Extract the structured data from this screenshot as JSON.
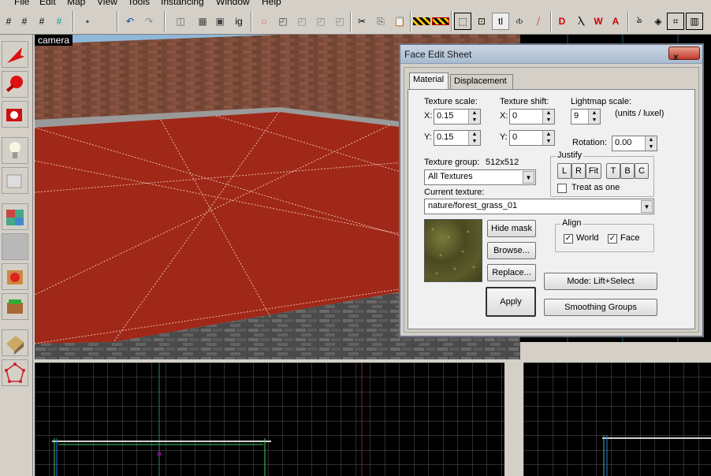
{
  "menubar": {
    "items": [
      "File",
      "Edit",
      "Map",
      "View",
      "Tools",
      "Instancing",
      "Window",
      "Help"
    ]
  },
  "toolbar": {
    "icons": [
      "grid-icon",
      "grid-smaller-icon",
      "grid-larger-icon",
      "undo-icon",
      "redo-icon",
      "ig-label",
      "cut-icon",
      "copy-icon",
      "paste-icon",
      "hazard-icon",
      "texture-lock-icon",
      "t-label"
    ],
    "ig_label": "ig",
    "t_label": "tl"
  },
  "camera": {
    "label": "camera"
  },
  "dialog": {
    "title": "Face Edit Sheet",
    "close_label": "x",
    "tabs": [
      "Material",
      "Displacement"
    ],
    "texture_scale_label": "Texture scale:",
    "texture_shift_label": "Texture shift:",
    "lightmap_scale_label": "Lightmap scale:",
    "units_label": "(units / luxel)",
    "x_label": "X:",
    "y_label": "Y:",
    "scale_x": "0.15",
    "scale_y": "0.15",
    "shift_x": "0",
    "shift_y": "0",
    "lightmap": "9",
    "rotation_label": "Rotation:",
    "rotation": "0.00",
    "texture_group_label": "Texture group:",
    "texture_size": "512x512",
    "texture_group": "All Textures",
    "justify_label": "Justify",
    "justify_buttons": [
      "L",
      "R",
      "Fit",
      "T",
      "B",
      "C"
    ],
    "treat_as_one": "Treat as one",
    "current_texture_label": "Current texture:",
    "current_texture": "nature/forest_grass_01",
    "hide_mask": "Hide mask",
    "browse": "Browse...",
    "replace": "Replace...",
    "apply": "Apply",
    "align_label": "Align",
    "align_world": "World",
    "align_face": "Face",
    "mode": "Mode: Lift+Select",
    "smoothing": "Smoothing Groups"
  }
}
